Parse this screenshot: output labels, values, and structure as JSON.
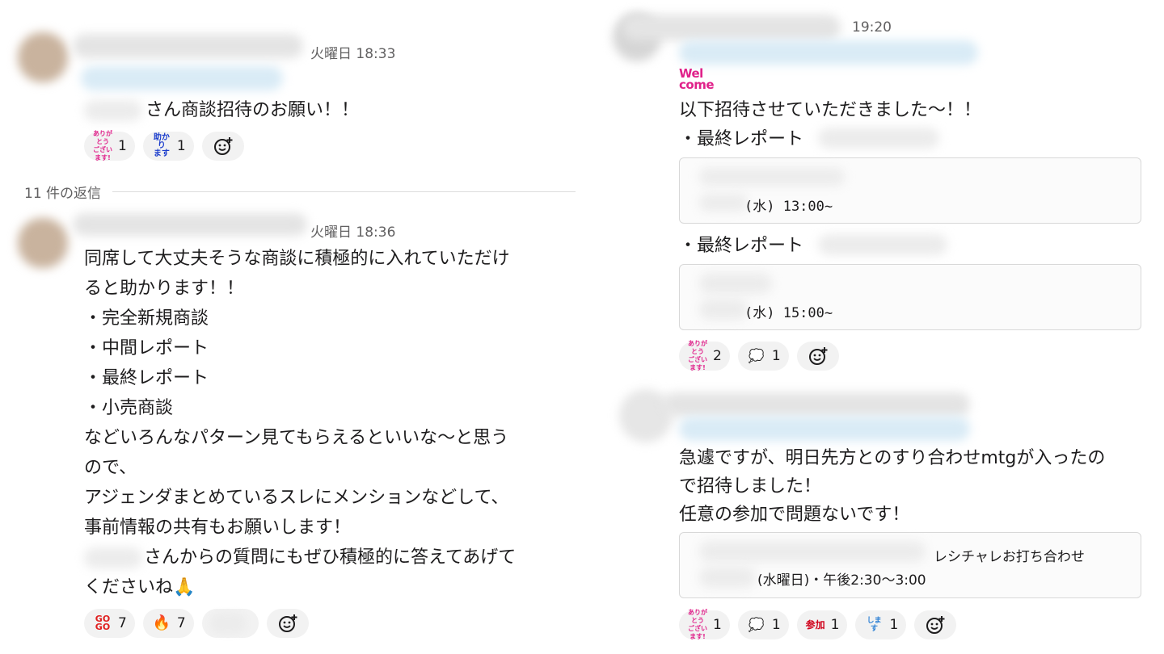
{
  "left": {
    "parent": {
      "timestamp": "火曜日 18:33",
      "text": "さん商談招待のお願い！！",
      "reactions": [
        {
          "emoji": "ありがとう\nございます!",
          "count": "1",
          "color": "#e0218a"
        },
        {
          "emoji": "助かり\nます",
          "count": "1",
          "color": "#1a3ccc"
        }
      ]
    },
    "replies_label": "11 件の返信",
    "reply": {
      "timestamp": "火曜日 18:36",
      "lines": [
        "同席して大丈夫そうな商談に積極的に入れていただけ",
        "ると助かります！！",
        "・完全新規商談",
        "・中間レポート",
        "・最終レポート",
        "・小売商談",
        "などいろんなパターン見てもらえるといいな〜と思う",
        "ので、",
        "アジェンダまとめているスレにメンションなどして、",
        "事前情報の共有もお願いします！",
        "さんからの質問にもぜひ積極的に答えてあげて",
        "くださいね🙏"
      ],
      "reactions": [
        {
          "emoji": "GO\nGO",
          "count": "7",
          "color": "#e01e1e"
        },
        {
          "emoji": "🔥",
          "count": "7",
          "color": "#f26b1d"
        }
      ]
    }
  },
  "right": {
    "msg1": {
      "timestamp": "19:20",
      "welcome_logo": "Wel come",
      "line1": "以下招待させていただきました〜！！",
      "item1": "・最終レポート",
      "card1_time": "(水) 13:00~",
      "item2": "・最終レポート",
      "card2_time": "(水) 15:00~",
      "reactions": [
        {
          "emoji": "ありがとう\nございます!",
          "count": "2",
          "color": "#e0218a"
        },
        {
          "emoji": "💭",
          "count": "1",
          "color": "#888888"
        }
      ]
    },
    "msg2": {
      "lines": [
        "急遽ですが、明日先方とのすり合わせmtgが入ったの",
        "で招待しました！",
        "任意の参加で問題ないです！"
      ],
      "card_title": "レシチャレお打ち合わせ",
      "card_time": "(水曜日)・午後2:30〜3:00",
      "reactions": [
        {
          "emoji": "ありがとう\nございます!",
          "count": "1",
          "color": "#e0218a"
        },
        {
          "emoji": "💭",
          "count": "1",
          "color": "#888888"
        },
        {
          "emoji": "参加",
          "count": "1",
          "color": "#d0021b"
        },
        {
          "emoji": "します",
          "count": "1",
          "color": "#2a7fd4"
        }
      ]
    }
  }
}
